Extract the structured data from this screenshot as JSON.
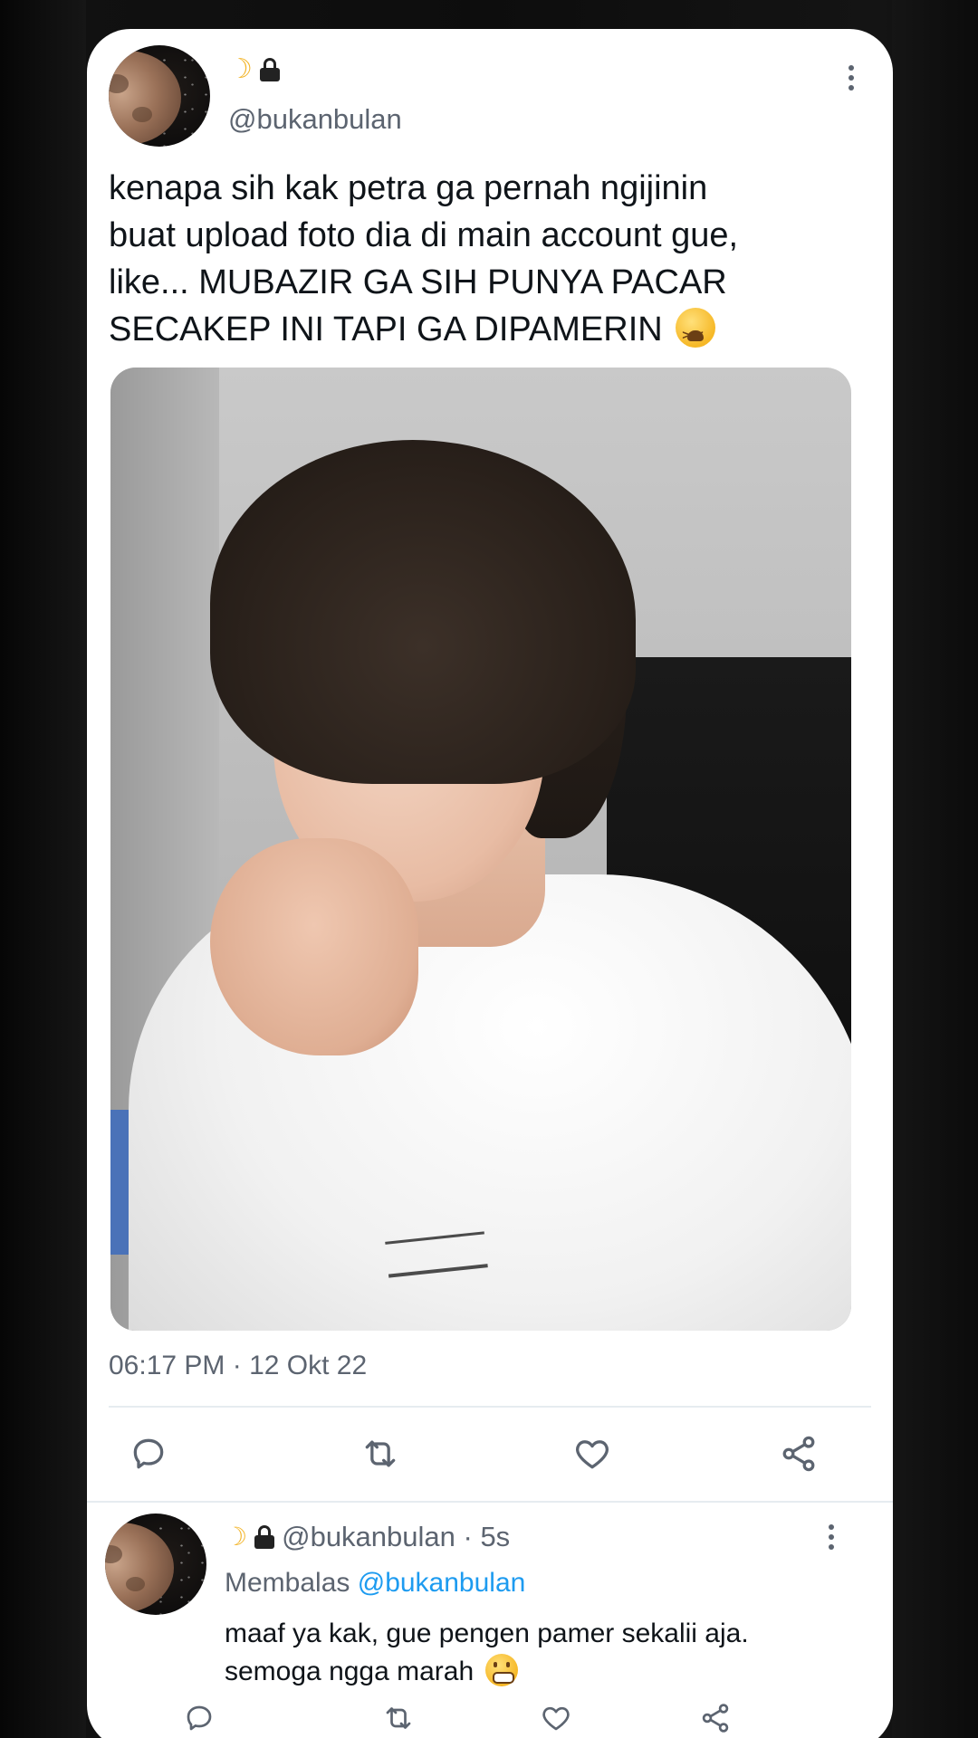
{
  "tweet": {
    "moon_glyph": "☽",
    "handle": "@bukanbulan",
    "text_lines": [
      "kenapa sih kak petra ga pernah ngijinin",
      "buat upload foto dia di main account gue,",
      "like... MUBAZIR GA SIH PUNYA PACAR",
      "SECAKEP INI TAPI GA DIPAMERIN"
    ],
    "timestamp": "06:17 PM · 12 Okt 22"
  },
  "reply": {
    "moon_glyph": "☽",
    "handle_line": "@bukanbulan · 5s",
    "replying_prefix": "Membalas",
    "replying_mention": "@bukanbulan",
    "text_line1": "maaf ya kak, gue pengen pamer sekalii aja.",
    "text_line2": "semoga ngga marah"
  },
  "icons": {
    "reply": "reply-icon",
    "retweet": "retweet-icon",
    "like": "heart-icon",
    "share": "share-icon",
    "more": "more-vertical-icon",
    "lock": "lock-icon"
  },
  "colors": {
    "text_primary": "#0f1419",
    "text_secondary": "#5c6470",
    "mention": "#1d9bf0",
    "card_bg": "#ffffff",
    "page_bg": "#050505"
  }
}
